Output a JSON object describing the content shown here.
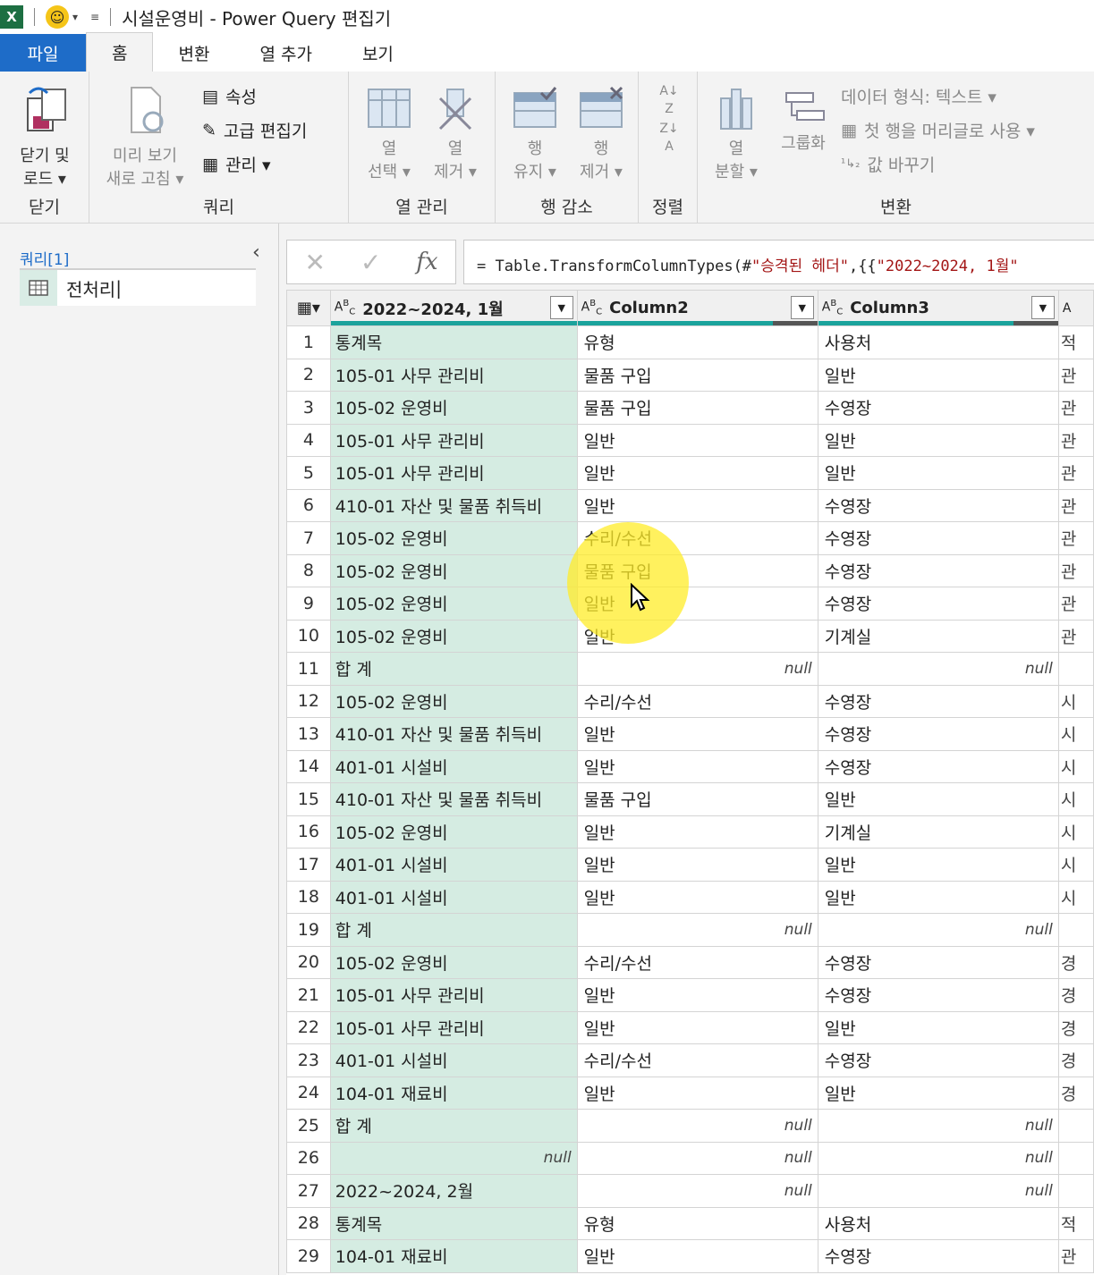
{
  "window": {
    "title": "시설운영비 - Power Query 편집기",
    "app_icon": "X"
  },
  "menu": {
    "file": "파일",
    "home": "홈",
    "transform": "변환",
    "add_column": "열 추가",
    "view": "보기"
  },
  "ribbon": {
    "close_group": {
      "label": "닫기",
      "close_load": "닫기 및",
      "close_load2": "로드 ▾"
    },
    "query_group": {
      "label": "쿼리",
      "refresh_preview": "미리 보기",
      "refresh_preview2": "새로 고침 ▾",
      "properties": "속성",
      "advanced_editor": "고급 편집기",
      "manage": "관리 ▾"
    },
    "manage_columns_group": {
      "label": "열 관리",
      "choose_columns": "열",
      "choose_columns2": "선택 ▾",
      "remove_columns": "열",
      "remove_columns2": "제거 ▾"
    },
    "reduce_rows_group": {
      "label": "행 감소",
      "keep_rows": "행",
      "keep_rows2": "유지 ▾",
      "remove_rows": "행",
      "remove_rows2": "제거 ▾"
    },
    "sort_group": {
      "label": "정렬"
    },
    "transform_group": {
      "label": "변환",
      "split_column": "열",
      "split_column2": "분할 ▾",
      "group_by": "그룹화",
      "data_type": "데이터 형식: 텍스트 ▾",
      "use_first_row": "첫 행을 머리글로 사용 ▾",
      "replace_values": "값 바꾸기"
    }
  },
  "sidebar": {
    "header": "쿼리[1]",
    "query_name": "전처리"
  },
  "formula_bar": {
    "prefix": "= Table.TransformColumnTypes(#",
    "str1": "\"승격된 헤더\"",
    "mid": ",{{",
    "str2": "\"2022~2024, 1월\""
  },
  "grid": {
    "columns": [
      {
        "name": "2022~2024, 1월",
        "type": "ABC"
      },
      {
        "name": "Column2",
        "type": "ABC"
      },
      {
        "name": "Column3",
        "type": "ABC"
      },
      {
        "name": "",
        "type": "A"
      }
    ],
    "rows": [
      [
        "1",
        "통계목",
        "유형",
        "사용처",
        "적"
      ],
      [
        "2",
        "105-01 사무 관리비",
        "물품 구입",
        "일반",
        "관"
      ],
      [
        "3",
        "105-02 운영비",
        "물품 구입",
        "수영장",
        "관"
      ],
      [
        "4",
        "105-01 사무 관리비",
        "일반",
        "일반",
        "관"
      ],
      [
        "5",
        "105-01 사무 관리비",
        "일반",
        "일반",
        "관"
      ],
      [
        "6",
        "410-01 자산 및 물품 취득비",
        "일반",
        "수영장",
        "관"
      ],
      [
        "7",
        "105-02 운영비",
        "수리/수선",
        "수영장",
        "관"
      ],
      [
        "8",
        "105-02 운영비",
        "물품 구입",
        "수영장",
        "관"
      ],
      [
        "9",
        "105-02 운영비",
        "일반",
        "수영장",
        "관"
      ],
      [
        "10",
        "105-02 운영비",
        "일반",
        "기계실",
        "관"
      ],
      [
        "11",
        "합  계",
        "null",
        "null",
        ""
      ],
      [
        "12",
        "105-02 운영비",
        "수리/수선",
        "수영장",
        "시"
      ],
      [
        "13",
        "410-01 자산 및 물품 취득비",
        "일반",
        "수영장",
        "시"
      ],
      [
        "14",
        "401-01 시설비",
        "일반",
        "수영장",
        "시"
      ],
      [
        "15",
        "410-01 자산 및 물품 취득비",
        "물품 구입",
        "일반",
        "시"
      ],
      [
        "16",
        "105-02 운영비",
        "일반",
        "기계실",
        "시"
      ],
      [
        "17",
        "401-01 시설비",
        "일반",
        "일반",
        "시"
      ],
      [
        "18",
        "401-01 시설비",
        "일반",
        "일반",
        "시"
      ],
      [
        "19",
        "합  계",
        "null",
        "null",
        ""
      ],
      [
        "20",
        "105-02 운영비",
        "수리/수선",
        "수영장",
        "경"
      ],
      [
        "21",
        "105-01 사무 관리비",
        "일반",
        "수영장",
        "경"
      ],
      [
        "22",
        "105-01 사무 관리비",
        "일반",
        "일반",
        "경"
      ],
      [
        "23",
        "401-01 시설비",
        "수리/수선",
        "수영장",
        "경"
      ],
      [
        "24",
        "104-01 재료비",
        "일반",
        "일반",
        "경"
      ],
      [
        "25",
        "합  계",
        "null",
        "null",
        ""
      ],
      [
        "26",
        "null",
        "null",
        "null",
        ""
      ],
      [
        "27",
        "2022~2024, 2월",
        "null",
        "null",
        ""
      ],
      [
        "28",
        "통계목",
        "유형",
        "사용처",
        "적"
      ],
      [
        "29",
        "104-01 재료비",
        "일반",
        "수영장",
        "관"
      ]
    ]
  },
  "colors": {
    "accent": "#1e6cc8",
    "selected_column": "#d5ece2",
    "quality_bar": "#1ba39c",
    "highlight": "#ffec28"
  }
}
